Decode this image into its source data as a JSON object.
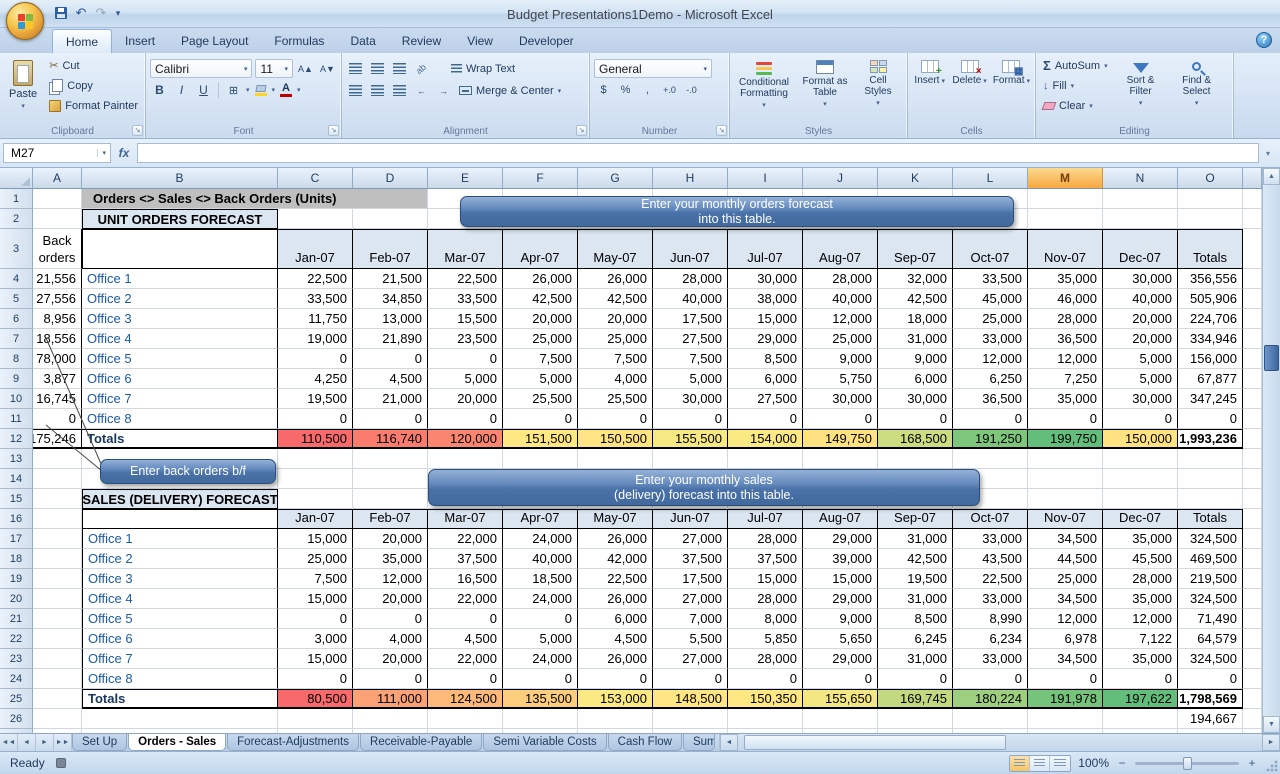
{
  "title_bar": {
    "title": "Budget Presentations1Demo - Microsoft Excel"
  },
  "ribbon": {
    "tabs": [
      "Home",
      "Insеrt",
      "Page Layout",
      "Formulas",
      "Data",
      "Review",
      "View",
      "Developer"
    ],
    "active_tab": "Home",
    "clipboard": {
      "label": "Clipboard",
      "paste": "Paste",
      "cut": "Cut",
      "copy": "Copy",
      "format_painter": "Format Painter"
    },
    "font": {
      "label": "Font",
      "name": "Calibri",
      "size": "11"
    },
    "alignment": {
      "label": "Alignment",
      "wrap_text": "Wrap Text",
      "merge_center": "Merge & Center"
    },
    "number": {
      "label": "Number",
      "format": "General"
    },
    "styles": {
      "label": "Styles",
      "items": [
        "Conditional Formatting",
        "Format as Table",
        "Cell Styles"
      ]
    },
    "cells": {
      "label": "Cells",
      "items": [
        "Insert",
        "Delete",
        "Format"
      ]
    },
    "editing": {
      "label": "Editing",
      "autosum": "AutoSum",
      "fill": "Fill",
      "clear": "Clear",
      "sort_filter": "Sort & Filter",
      "find_select": "Find & Select"
    }
  },
  "formula_bar": {
    "name_box": "M27",
    "formula": ""
  },
  "grid": {
    "col_letters": [
      "A",
      "B",
      "C",
      "D",
      "E",
      "F",
      "G",
      "H",
      "I",
      "J",
      "K",
      "L",
      "M",
      "N",
      "O"
    ],
    "selected_col": "M",
    "row_count": 26,
    "months": [
      "Jan-07",
      "Feb-07",
      "Mar-07",
      "Apr-07",
      "May-07",
      "Jun-07",
      "Jul-07",
      "Aug-07",
      "Sep-07",
      "Oct-07",
      "Nov-07",
      "Dec-07"
    ],
    "totals_col_label": "Totals"
  },
  "sheet": {
    "row1_label": "Orders <> Sales <> Back Orders (Units)",
    "back_orders_label": "Back orders",
    "orders": {
      "title": "UNIT ORDERS FORECAST",
      "rows": [
        {
          "back": "21,556",
          "office": "Office 1",
          "values": [
            "22,500",
            "21,500",
            "22,500",
            "26,000",
            "26,000",
            "28,000",
            "30,000",
            "28,000",
            "32,000",
            "33,500",
            "35,000",
            "30,000"
          ],
          "total": "356,556"
        },
        {
          "back": "27,556",
          "office": "Office 2",
          "values": [
            "33,500",
            "34,850",
            "33,500",
            "42,500",
            "42,500",
            "40,000",
            "38,000",
            "40,000",
            "42,500",
            "45,000",
            "46,000",
            "40,000"
          ],
          "total": "505,906"
        },
        {
          "back": "8,956",
          "office": "Office 3",
          "values": [
            "11,750",
            "13,000",
            "15,500",
            "20,000",
            "20,000",
            "17,500",
            "15,000",
            "12,000",
            "18,000",
            "25,000",
            "28,000",
            "20,000"
          ],
          "total": "224,706"
        },
        {
          "back": "18,556",
          "office": "Office 4",
          "values": [
            "19,000",
            "21,890",
            "23,500",
            "25,000",
            "25,000",
            "27,500",
            "29,000",
            "25,000",
            "31,000",
            "33,000",
            "36,500",
            "20,000"
          ],
          "total": "334,946"
        },
        {
          "back": "78,000",
          "office": "Office 5",
          "values": [
            "0",
            "0",
            "0",
            "7,500",
            "7,500",
            "7,500",
            "8,500",
            "9,000",
            "9,000",
            "12,000",
            "12,000",
            "5,000"
          ],
          "total": "156,000"
        },
        {
          "back": "3,877",
          "office": "Office 6",
          "values": [
            "4,250",
            "4,500",
            "5,000",
            "5,000",
            "4,000",
            "5,000",
            "6,000",
            "5,750",
            "6,000",
            "6,250",
            "7,250",
            "5,000"
          ],
          "total": "67,877"
        },
        {
          "back": "16,745",
          "office": "Office 7",
          "values": [
            "19,500",
            "21,000",
            "20,000",
            "25,500",
            "25,500",
            "30,000",
            "27,500",
            "30,000",
            "30,000",
            "36,500",
            "35,000",
            "30,000"
          ],
          "total": "347,245"
        },
        {
          "back": "0",
          "office": "Office 8",
          "values": [
            "0",
            "0",
            "0",
            "0",
            "0",
            "0",
            "0",
            "0",
            "0",
            "0",
            "0",
            "0"
          ],
          "total": "0"
        }
      ],
      "totals": {
        "back": "175,246",
        "label": "Totals",
        "values": [
          "110,500",
          "116,740",
          "120,000",
          "151,500",
          "150,500",
          "155,500",
          "154,000",
          "149,750",
          "168,500",
          "191,250",
          "199,750",
          "150,000"
        ],
        "colors": [
          "#F8696B",
          "#F97C6F",
          "#FA8671",
          "#FFE783",
          "#FFE483",
          "#F6E883",
          "#FBEA84",
          "#FEE282",
          "#CBDC81",
          "#7FC67D",
          "#63BE7B",
          "#FFE382"
        ],
        "total": "1,993,236"
      }
    },
    "sales": {
      "title": "SALES (DELIVERY) FORECAST",
      "rows": [
        {
          "office": "Office 1",
          "values": [
            "15,000",
            "20,000",
            "22,000",
            "24,000",
            "26,000",
            "27,000",
            "28,000",
            "29,000",
            "31,000",
            "33,000",
            "34,500",
            "35,000"
          ],
          "total": "324,500"
        },
        {
          "office": "Office 2",
          "values": [
            "25,000",
            "35,000",
            "37,500",
            "40,000",
            "42,000",
            "37,500",
            "37,500",
            "39,000",
            "42,500",
            "43,500",
            "44,500",
            "45,500"
          ],
          "total": "469,500"
        },
        {
          "office": "Office 3",
          "values": [
            "7,500",
            "12,000",
            "16,500",
            "18,500",
            "22,500",
            "17,500",
            "15,000",
            "15,000",
            "19,500",
            "22,500",
            "25,000",
            "28,000"
          ],
          "total": "219,500"
        },
        {
          "office": "Office 4",
          "values": [
            "15,000",
            "20,000",
            "22,000",
            "24,000",
            "26,000",
            "27,000",
            "28,000",
            "29,000",
            "31,000",
            "33,000",
            "34,500",
            "35,000"
          ],
          "total": "324,500"
        },
        {
          "office": "Office 5",
          "values": [
            "0",
            "0",
            "0",
            "0",
            "6,000",
            "7,000",
            "8,000",
            "9,000",
            "8,500",
            "8,990",
            "12,000",
            "12,000"
          ],
          "total": "71,490"
        },
        {
          "office": "Office 6",
          "values": [
            "3,000",
            "4,000",
            "4,500",
            "5,000",
            "4,500",
            "5,500",
            "5,850",
            "5,650",
            "6,245",
            "6,234",
            "6,978",
            "7,122"
          ],
          "total": "64,579"
        },
        {
          "office": "Office 7",
          "values": [
            "15,000",
            "20,000",
            "22,000",
            "24,000",
            "26,000",
            "27,000",
            "28,000",
            "29,000",
            "31,000",
            "33,000",
            "34,500",
            "35,000"
          ],
          "total": "324,500"
        },
        {
          "office": "Office 8",
          "values": [
            "0",
            "0",
            "0",
            "0",
            "0",
            "0",
            "0",
            "0",
            "0",
            "0",
            "0",
            "0"
          ],
          "total": "0"
        }
      ],
      "totals": {
        "label": "Totals",
        "values": [
          "80,500",
          "111,000",
          "124,500",
          "135,500",
          "153,000",
          "148,500",
          "150,350",
          "155,650",
          "169,745",
          "180,224",
          "191,978",
          "197,622"
        ],
        "colors": [
          "#F8696B",
          "#FBA176",
          "#FCB97A",
          "#FDCD7E",
          "#FBEA84",
          "#FFE583",
          "#FFE883",
          "#F2E783",
          "#C2D980",
          "#9ECF7E",
          "#76C47C",
          "#63BE7B"
        ],
        "total": "1,798,569"
      }
    },
    "partial_row26_total": "194,667"
  },
  "callouts": {
    "orders_line1": "Enter your monthly  orders forecast",
    "orders_line2": "into this table.",
    "back_orders": "Enter back orders b/f",
    "sales_line1": "Enter your monthly sales",
    "sales_line2": "(delivery) forecast into this table."
  },
  "sheet_tabs": {
    "tabs": [
      "Set Up",
      "Orders - Sales",
      "Forecast-Adjustments",
      "Receivable-Payable",
      "Semi Variable Costs",
      "Cash Flow",
      "Sum"
    ],
    "active": "Orders - Sales"
  },
  "status_bar": {
    "mode": "Ready",
    "zoom": "100%"
  },
  "icons": {
    "cut": "✂",
    "undo": "↶",
    "redo": "↷",
    "dropdown": "▾",
    "launcher": "↘",
    "sigma": "Σ",
    "currency": "$",
    "percent": "%",
    "comma": ",",
    "inc_decimal": "+.0",
    "dec_decimal": "-.0",
    "bold": "B",
    "italic": "I",
    "underline": "U",
    "borders": "⊞",
    "fx": "fx",
    "help": "?",
    "grow_font": "A▲",
    "shrink_font": "A▼",
    "letter_a": "A",
    "fill_arrow": "↓",
    "orientation": "ab",
    "indent_dec": "←",
    "indent_inc": "→",
    "scroll_up": "▲",
    "scroll_down": "▼",
    "scroll_left": "◄",
    "scroll_right": "►",
    "tab_first": "◄◄",
    "tab_prev": "◄",
    "tab_next": "►",
    "tab_last": "►►",
    "minus": "−",
    "plus": "+"
  }
}
